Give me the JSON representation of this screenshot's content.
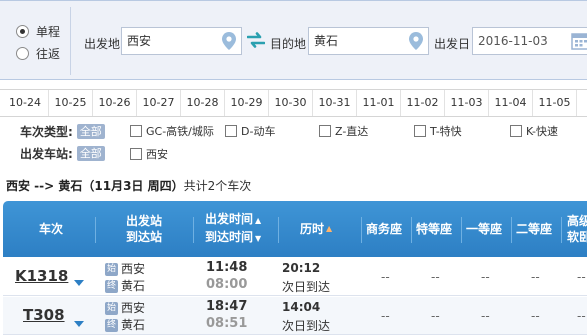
{
  "search": {
    "trip_type": {
      "single": "单程",
      "round": "往返",
      "selected": "single"
    },
    "from": {
      "label": "出发地",
      "value": "西安"
    },
    "to": {
      "label": "目的地",
      "value": "黄石"
    },
    "date": {
      "label": "出发日",
      "value": "2016-11-03"
    }
  },
  "dates": [
    "10-24",
    "10-25",
    "10-26",
    "10-27",
    "10-28",
    "10-29",
    "10-30",
    "10-31",
    "11-01",
    "11-02",
    "11-03",
    "11-04",
    "11-05"
  ],
  "filters": {
    "train_type": {
      "label": "车次类型:",
      "all": "全部",
      "options": [
        "GC-高铁/城际",
        "D-动车",
        "Z-直达",
        "T-特快",
        "K-快速"
      ]
    },
    "station": {
      "label": "出发车站:",
      "all": "全部",
      "options": [
        "西安"
      ]
    }
  },
  "summary": {
    "route": "西安 --> 黄石（11月3日  周四）",
    "count_text": "共计2个车次"
  },
  "table": {
    "headers": {
      "train": "车次",
      "station_1": "出发站",
      "station_2": "到达站",
      "time_1": "出发时间",
      "time_2": "到达时间",
      "duration": "历时",
      "business": "商务座",
      "special": "特等座",
      "first": "一等座",
      "second": "二等座",
      "high_1": "高级",
      "high_2": "软卧"
    },
    "station_icon_from": "始",
    "station_icon_to": "终",
    "rows": [
      {
        "train": "K1318",
        "from": "西安",
        "to": "黄石",
        "depart": "11:48",
        "arrive": "08:00",
        "duration": "20:12",
        "note": "次日到达",
        "business": "--",
        "special": "--",
        "first": "--",
        "second": "--",
        "high": "--"
      },
      {
        "train": "T308",
        "from": "西安",
        "to": "黄石",
        "depart": "18:47",
        "arrive": "08:51",
        "duration": "14:04",
        "note": "次日到达",
        "business": "--",
        "special": "--",
        "first": "--",
        "second": "--",
        "high": "--"
      }
    ]
  },
  "colors": {
    "header_blue": "#2d7fc4",
    "panel_bg": "#eef1f8",
    "pin_blue": "#8fb6dc",
    "swap_teal": "#2aa0b0"
  }
}
